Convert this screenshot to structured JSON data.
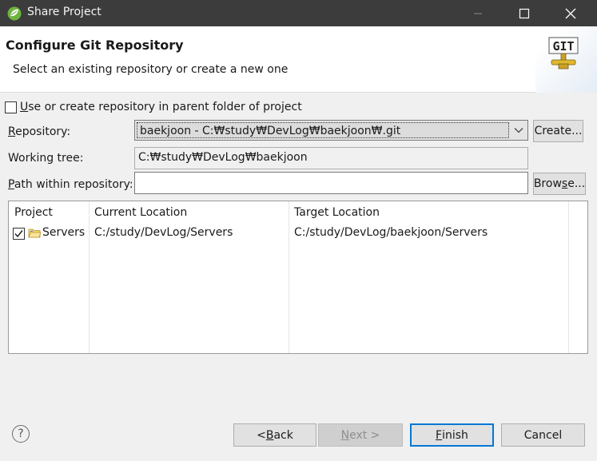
{
  "window": {
    "title": "Share Project"
  },
  "header": {
    "title": "Configure Git Repository",
    "subtitle": "Select an existing repository or create a new one",
    "banner_text": "GIT"
  },
  "parent_folder_checkbox": {
    "checked": false,
    "label_mnemonic": "U",
    "label_rest": "se or create repository in parent folder of project"
  },
  "repository": {
    "label_mnemonic": "R",
    "label_rest": "epository:",
    "value": "baekjoon - C:₩study₩DevLog₩baekjoon₩.git",
    "create_label": "Create..."
  },
  "working_tree": {
    "label": "Working tree:",
    "value": "C:₩study₩DevLog₩baekjoon"
  },
  "path_within": {
    "label_mnemonic": "P",
    "label_rest": "ath within repository:",
    "value": "",
    "browse_pre": "Brow",
    "browse_mnemonic": "s",
    "browse_post": "e..."
  },
  "table": {
    "columns": [
      "Project",
      "Current Location",
      "Target Location"
    ],
    "rows": [
      {
        "checked": true,
        "project": "Servers",
        "current": "C:/study/DevLog/Servers",
        "target": "C:/study/DevLog/baekjoon/Servers"
      }
    ]
  },
  "footer": {
    "help_symbol": "?",
    "back_pre": "< ",
    "back_mnemonic": "B",
    "back_post": "ack",
    "next_mnemonic": "N",
    "next_post": "ext >",
    "finish_mnemonic": "F",
    "finish_post": "inish",
    "cancel_label": "Cancel"
  },
  "colors": {
    "titlebar": "#3c3c3c",
    "accent": "#0078d7",
    "spring_green": "#6db33f"
  }
}
